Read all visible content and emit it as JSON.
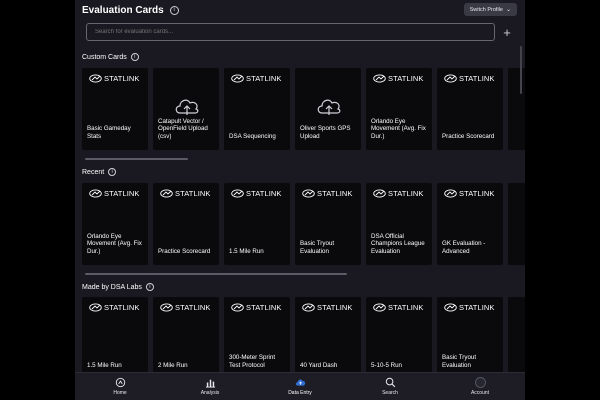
{
  "header": {
    "title": "Evaluation Cards",
    "switch_label": "Switch Profile"
  },
  "search": {
    "placeholder": "Search for evaluation cards..."
  },
  "brand": {
    "logo_text": "STATLINK"
  },
  "sections": {
    "custom": {
      "title": "Custom Cards",
      "cards": [
        {
          "label": "Basic Gameday Stats",
          "icon": ""
        },
        {
          "label": "Catapult Vector / OpenField Upload (csv)",
          "icon": "cloud-upload-icon"
        },
        {
          "label": "DSA Sequencing",
          "icon": ""
        },
        {
          "label": "Oliver Sports GPS Upload",
          "icon": "cloud-upload-icon"
        },
        {
          "label": "Orlando Eye Movement (Avg. Fix Dur.)",
          "icon": ""
        },
        {
          "label": "Practice Scorecard",
          "icon": ""
        }
      ]
    },
    "recent": {
      "title": "Recent",
      "cards": [
        {
          "label": "Orlando Eye Movement (Avg. Fix Dur.)"
        },
        {
          "label": "Practice Scorecard"
        },
        {
          "label": "1.5 Mile Run"
        },
        {
          "label": "Basic Tryout Evaluation"
        },
        {
          "label": "DSA Official Champions League Evaluation"
        },
        {
          "label": "GK Evaluation - Advanced"
        }
      ]
    },
    "dsa": {
      "title": "Made by DSA Labs",
      "cards": [
        {
          "label": "1.5 Mile Run"
        },
        {
          "label": "2 Mile Run"
        },
        {
          "label": "300-Meter Sprint Test Protocol"
        },
        {
          "label": "40 Yard Dash"
        },
        {
          "label": "5-10-5 Run"
        },
        {
          "label": "Basic Tryout Evaluation"
        }
      ]
    }
  },
  "nav": {
    "items": [
      {
        "label": "Home",
        "icon": "home-icon"
      },
      {
        "label": "Analysis",
        "icon": "bar-chart-icon"
      },
      {
        "label": "Data Entry",
        "icon": "cloud-upload-icon",
        "active": true
      },
      {
        "label": "Search",
        "icon": "search-icon"
      },
      {
        "label": "Account",
        "icon": "avatar-icon"
      }
    ]
  },
  "colors": {
    "background": "#1a1921",
    "card": "#0a0a0d",
    "active_nav": "#2f6fd6"
  }
}
